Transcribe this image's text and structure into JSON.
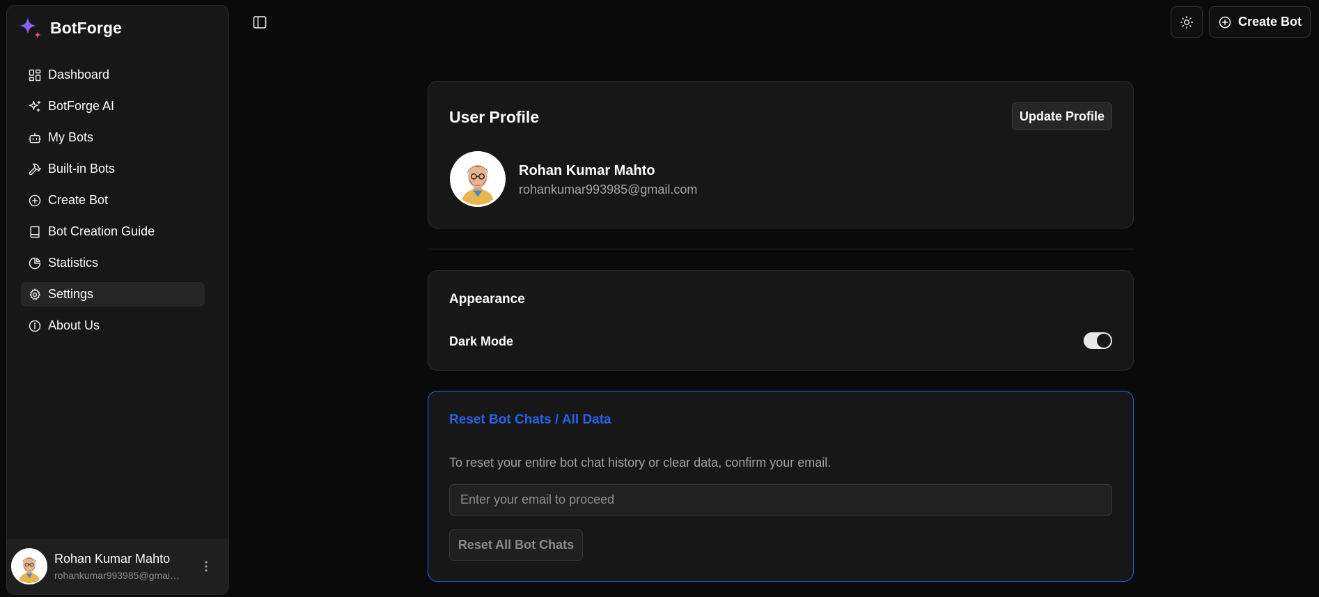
{
  "brand": {
    "name": "BotForge",
    "icon": "sparkle-logo-icon"
  },
  "sidebar": {
    "items": [
      {
        "label": "Dashboard",
        "icon": "dashboard-icon"
      },
      {
        "label": "BotForge AI",
        "icon": "sparkles-icon"
      },
      {
        "label": "My Bots",
        "icon": "bot-icon"
      },
      {
        "label": "Built-in Bots",
        "icon": "hammer-icon"
      },
      {
        "label": "Create Bot",
        "icon": "plus-circle-icon"
      },
      {
        "label": "Bot Creation Guide",
        "icon": "book-icon"
      },
      {
        "label": "Statistics",
        "icon": "pie-chart-icon"
      },
      {
        "label": "Settings",
        "icon": "gear-icon",
        "active": true
      },
      {
        "label": "About Us",
        "icon": "info-icon"
      }
    ],
    "user": {
      "name": "Rohan Kumar Mahto",
      "email": "rohankumar993985@gmail.com"
    }
  },
  "topbar": {
    "create_label": "Create Bot"
  },
  "profile": {
    "title": "User Profile",
    "update_label": "Update Profile",
    "name": "Rohan Kumar Mahto",
    "email": "rohankumar993985@gmail.com"
  },
  "appearance": {
    "title": "Appearance",
    "dark_mode_label": "Dark Mode",
    "dark_mode_on": true
  },
  "reset": {
    "title": "Reset Bot Chats / All Data",
    "description": "To reset your entire bot chat history or clear data, confirm your email.",
    "placeholder": "Enter your email to proceed",
    "value": "",
    "button_label": "Reset All Bot Chats"
  },
  "colors": {
    "background": "#0a0a0a",
    "panel": "#171717",
    "accent_blue": "#2563eb"
  }
}
